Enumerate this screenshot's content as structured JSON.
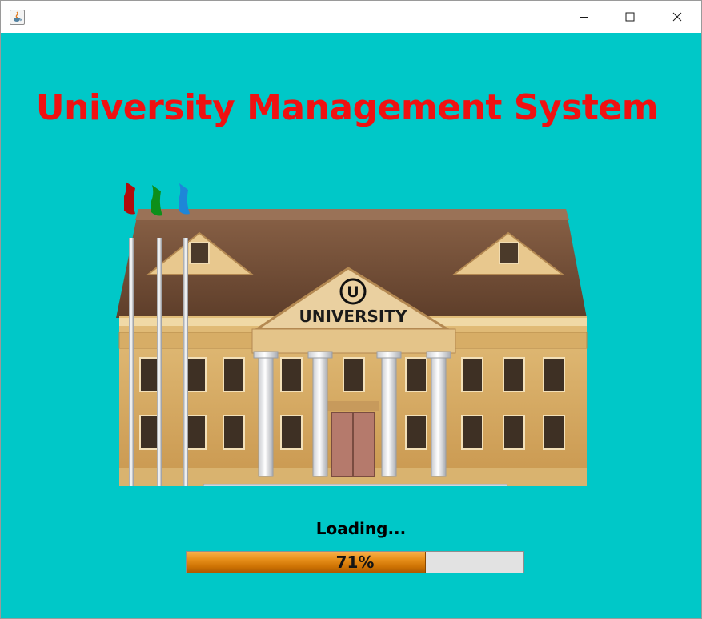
{
  "window": {
    "icon": "java-cup-icon",
    "controls": [
      "minimize-icon",
      "maximize-icon",
      "close-icon"
    ]
  },
  "main": {
    "heading": "University Management System",
    "heading_color": "#f01111",
    "background_color": "#00c8c8",
    "building_sign": "UNIVERSITY",
    "building_emblem": "U",
    "flag_colors": [
      "#b10c0c",
      "#0d8f1a",
      "#1e86d8"
    ]
  },
  "loading": {
    "label": "Loading...",
    "progress_percent": 71,
    "progress_text": "71%"
  }
}
